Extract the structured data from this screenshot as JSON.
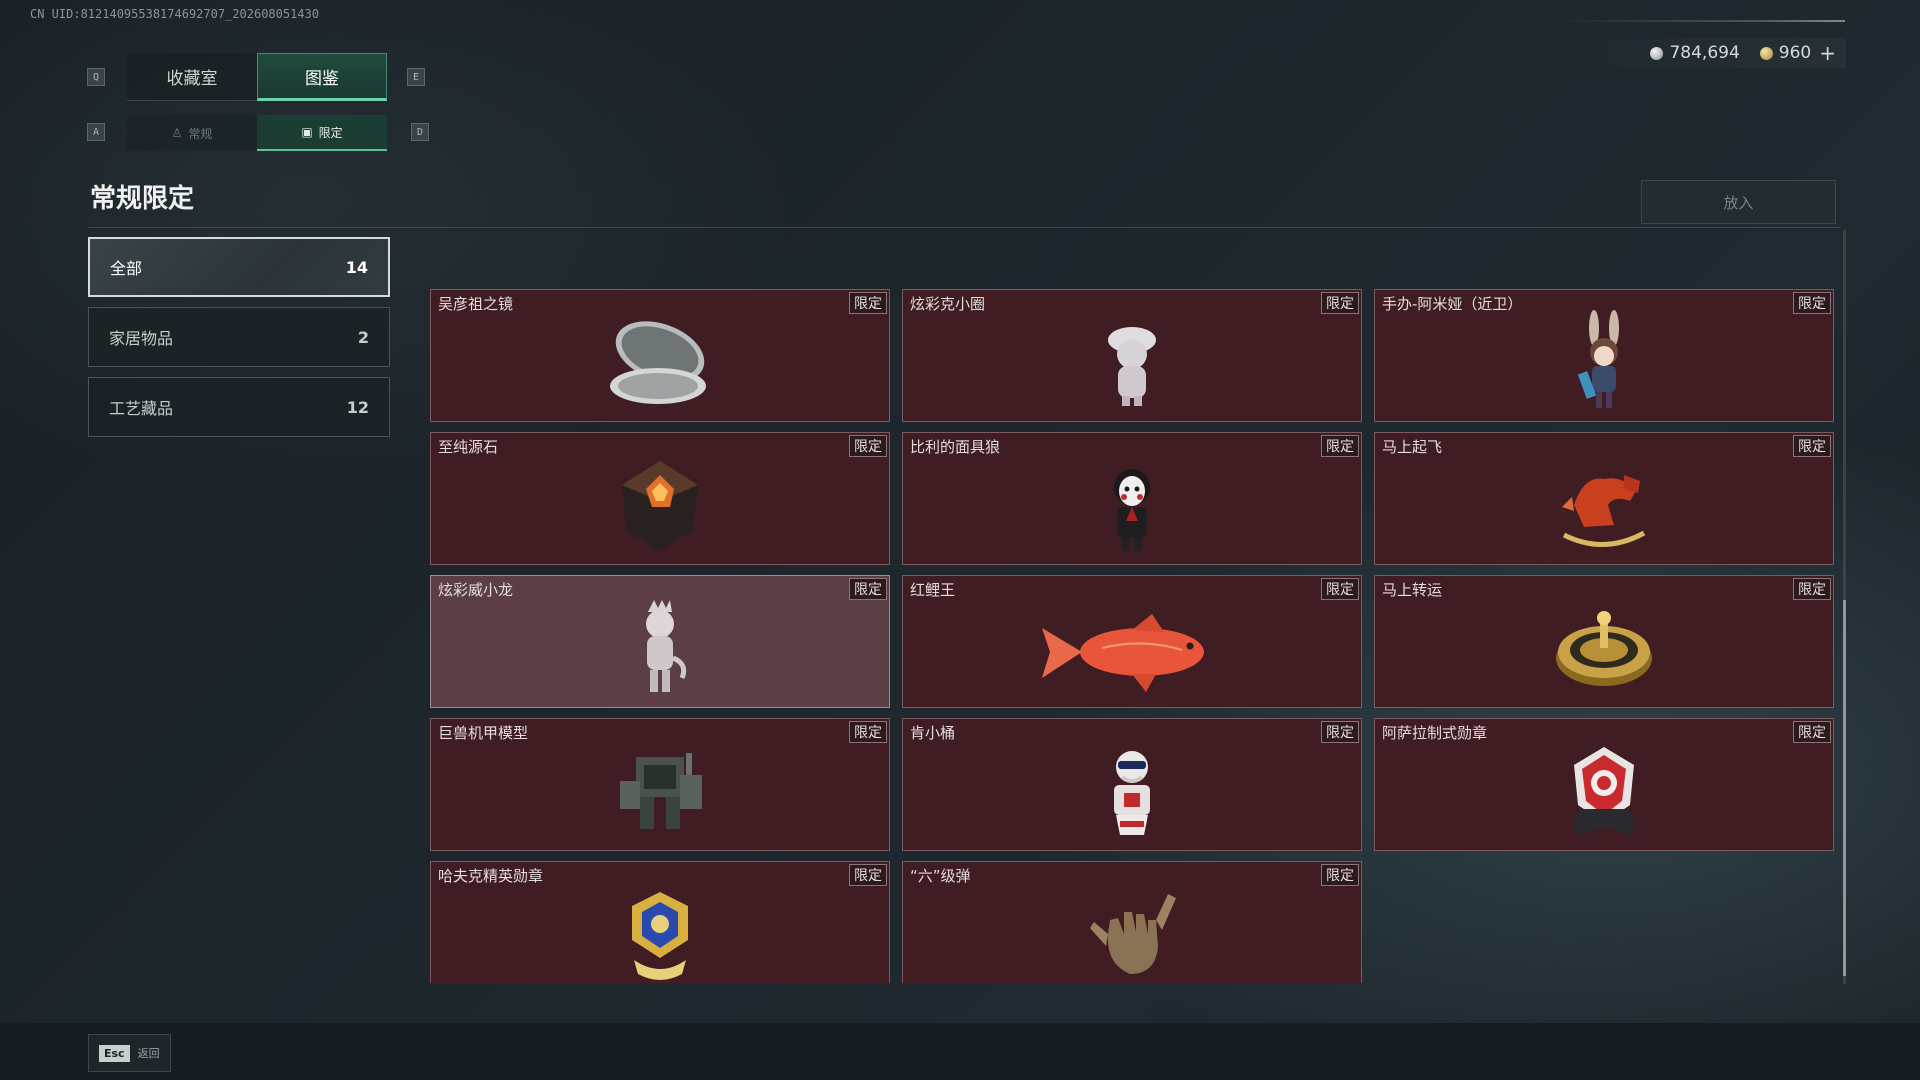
{
  "uid": "CN UID:8121409553817469270​7_202608051430",
  "currency": {
    "silver": "784,694",
    "gold": "960",
    "plus": "+"
  },
  "tabs": {
    "key_left": "Q",
    "key_right": "E",
    "items": [
      {
        "label": "收藏室",
        "active": false
      },
      {
        "label": "图鉴",
        "active": true
      }
    ]
  },
  "subtabs": {
    "key_left": "A",
    "key_right": "D",
    "items": [
      {
        "label": "常规",
        "active": false
      },
      {
        "label": "限定",
        "active": true
      }
    ]
  },
  "section_title": "常规限定",
  "place_button": "放入",
  "categories": [
    {
      "label": "全部",
      "count": "14",
      "active": true
    },
    {
      "label": "家居物品",
      "count": "2",
      "active": false
    },
    {
      "label": "工艺藏品",
      "count": "12",
      "active": false
    }
  ],
  "items": [
    {
      "name": "吴彦祖之镜",
      "badge": "限定",
      "icon": "compact-mirror-icon"
    },
    {
      "name": "炫彩克小圈",
      "badge": "限定",
      "icon": "figurine-cap-icon"
    },
    {
      "name": "手办-阿米娅（近卫）",
      "badge": "限定",
      "icon": "bunny-figure-icon"
    },
    {
      "name": "至纯源石",
      "badge": "限定",
      "icon": "originium-crystal-icon"
    },
    {
      "name": "比利的面具狼",
      "badge": "限定",
      "icon": "puppet-mask-icon"
    },
    {
      "name": "马上起飞",
      "badge": "限定",
      "icon": "rocking-horse-icon"
    },
    {
      "name": "炫彩威小龙",
      "badge": "限定",
      "icon": "dragon-figure-icon"
    },
    {
      "name": "红鲤王",
      "badge": "限定",
      "icon": "red-carp-icon"
    },
    {
      "name": "马上转运",
      "badge": "限定",
      "icon": "golden-compass-icon"
    },
    {
      "name": "巨兽机甲模型",
      "badge": "限定",
      "icon": "mech-model-icon"
    },
    {
      "name": "肯小桶",
      "badge": "限定",
      "icon": "bucket-figure-icon"
    },
    {
      "name": "阿萨拉制式勋章",
      "badge": "限定",
      "icon": "asala-medal-icon"
    },
    {
      "name": "哈夫克精英勋章",
      "badge": "限定",
      "icon": "haavk-medal-icon"
    },
    {
      "name": "“六”级弹",
      "badge": "限定",
      "icon": "hand-sign-icon"
    }
  ],
  "footer": {
    "esc_key": "Esc",
    "esc_label": "返回"
  }
}
